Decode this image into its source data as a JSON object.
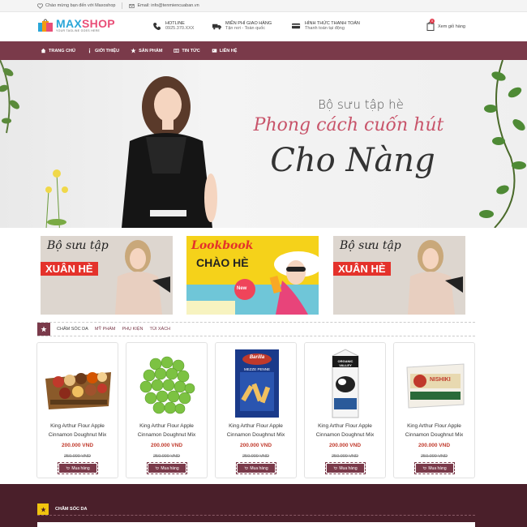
{
  "topbar": {
    "welcome": "Chào mừng bạn đến với Maxoshop",
    "email": "Email: info@tenmiencuaban.vn"
  },
  "header": {
    "logo": {
      "name_a": "MAX",
      "name_b": "SHOP",
      "tagline": "YOUR TAGLINE GOES HERE"
    },
    "hotline": {
      "title": "HOTLINE",
      "value": "0925.370.XXX"
    },
    "shipping": {
      "title": "MIỄN PHÍ GIAO HÀNG",
      "value": "Tận nơi - Toàn quốc"
    },
    "payment": {
      "title": "HÌNH THỨC THANH TOÁN",
      "value": "Thanh toán tại động"
    },
    "cart": {
      "label": "Xem giỏ hàng",
      "count": "0"
    }
  },
  "nav": {
    "items": [
      "TRANG CHỦ",
      "GIỚI THIỆU",
      "SẢN PHẨM",
      "TIN TỨC",
      "LIÊN HỆ"
    ]
  },
  "banner": {
    "line1": "Bộ sưu tập hè",
    "line2": "Phong cách cuốn hút",
    "line3": "Cho Nàng"
  },
  "promos": [
    {
      "t1": "Bộ sưu tập",
      "t2": "XUÂN HÈ"
    },
    {
      "t1": "Lookbook",
      "t2": "CHÀO HÈ",
      "badge": "New"
    },
    {
      "t1": "Bộ sưu tập",
      "t2": "XUÂN HÈ"
    }
  ],
  "tabs": [
    "CHĂM SÓC DA",
    "MỸ PHẨM",
    "PHỤ KIỆN",
    "TÚI XÁCH"
  ],
  "products": [
    {
      "name": "King Arthur Flour Apple Cinnamon Doughnut Mix",
      "price": "200.000 VND",
      "old_price": "250.000 VND",
      "buy": "Mua hàng",
      "image": "gift-basket"
    },
    {
      "name": "King Arthur Flour Apple Cinnamon Doughnut Mix",
      "price": "200.000 VND",
      "old_price": "250.000 VND",
      "buy": "Mua hàng",
      "image": "green-peas"
    },
    {
      "name": "King Arthur Flour Apple Cinnamon Doughnut Mix",
      "price": "200.000 VND",
      "old_price": "250.000 VND",
      "buy": "Mua hàng",
      "image": "pasta-box",
      "box_brand": "Barilla",
      "box_label": "MEZZE PENNE"
    },
    {
      "name": "King Arthur Flour Apple Cinnamon Doughnut Mix",
      "price": "200.000 VND",
      "old_price": "250.000 VND",
      "buy": "Mua hàng",
      "image": "milk-carton",
      "box_brand": "ORGANIC VALLEY"
    },
    {
      "name": "King Arthur Flour Apple Cinnamon Doughnut Mix",
      "price": "200.000 VND",
      "old_price": "250.000 VND",
      "buy": "Mua hàng",
      "image": "rice-bag",
      "box_brand": "NISHIKI"
    }
  ],
  "bottom": {
    "title": "CHĂM SÓC DA"
  },
  "colors": {
    "primary": "#7a3a4a",
    "dark": "#4a1f2a",
    "price": "#c0392b",
    "accent": "#f1c40f"
  }
}
